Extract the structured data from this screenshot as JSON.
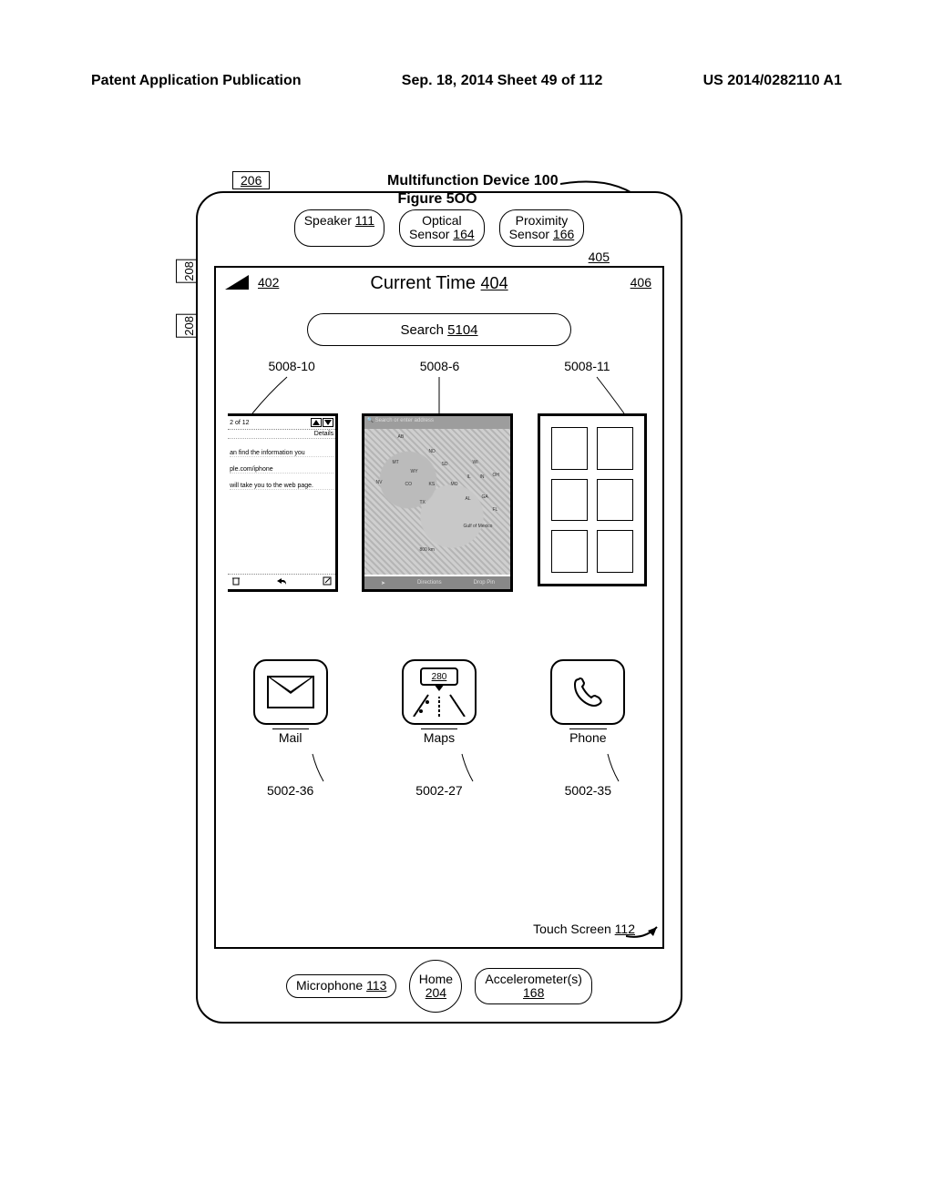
{
  "header": {
    "left": "Patent Application Publication",
    "center": "Sep. 18, 2014 Sheet 49 of 112",
    "right": "US 2014/0282110 A1"
  },
  "figure_title": "Multifunction Device 100",
  "figure_caption": "Figure 5OO",
  "refs": {
    "r206": "206",
    "r208": "208",
    "r405": "405",
    "r402": "402",
    "r404": "404",
    "r406": "406",
    "cards": {
      "left": "5008-10",
      "mid": "5008-6",
      "right": "5008-11"
    },
    "apps": {
      "mail": "5002-36",
      "maps": "5002-27",
      "phone": "5002-35"
    }
  },
  "sensors": {
    "speaker": {
      "label": "Speaker",
      "num": "111"
    },
    "optical": {
      "label1": "Optical",
      "label2": "Sensor",
      "num": "164"
    },
    "proximity": {
      "label1": "Proximity",
      "label2": "Sensor",
      "num": "166"
    }
  },
  "status": {
    "current_time": "Current Time"
  },
  "search": {
    "label": "Search",
    "num": "5104"
  },
  "card_left": {
    "count": "2 of 12",
    "details": "Details",
    "line1": "an find the information you",
    "line2": "ple.com/iphone",
    "line3": "will take you to the web page."
  },
  "card_mid": {
    "search_placeholder": "Search or enter address",
    "states": [
      "AB",
      "ND",
      "MT",
      "WY",
      "SD",
      "WI",
      "NV",
      "CO",
      "KS",
      "MO",
      "IL",
      "IN",
      "OH",
      "TX",
      "AL",
      "GA",
      "FL",
      "Gulf of Mexico",
      "800 km"
    ],
    "tabs": [
      "Directions",
      "Drop Pin"
    ]
  },
  "apps": {
    "mail": "Mail",
    "maps": "Maps",
    "maps_sign": "280",
    "phone": "Phone"
  },
  "bottom": {
    "mic": {
      "label": "Microphone",
      "num": "113"
    },
    "home": {
      "label": "Home",
      "num": "204"
    },
    "accel": {
      "label": "Accelerometer(s)",
      "num": "168"
    },
    "touchscreen": {
      "label": "Touch Screen",
      "num": "112"
    }
  }
}
